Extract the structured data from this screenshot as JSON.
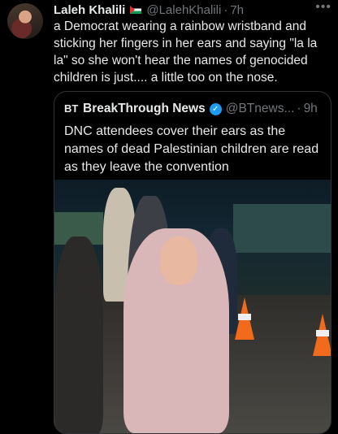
{
  "tweet": {
    "author_name": "Laleh Khalili",
    "handle": "@LalehKhalili",
    "separator": "·",
    "time": "7h",
    "more_icon": "more-horizontal-icon",
    "text": "a Democrat wearing a rainbow wristband and sticking her fingers in her ears and saying \"la la la\" so she won't hear the names of genocided children is just.... a little too on the nose."
  },
  "quote": {
    "logo_text": "BT",
    "author_name": "BreakThrough News",
    "verified_icon": "verified-badge-icon",
    "handle": "@BTnews...",
    "separator": "·",
    "time": "9h",
    "text": "DNC attendees cover their ears as the names of dead Palestinian children are read as they leave the convention"
  },
  "colors": {
    "background": "#000000",
    "text": "#e7e9ea",
    "secondary": "#71767b",
    "border": "#2f3336",
    "verified": "#1d9bf0"
  }
}
